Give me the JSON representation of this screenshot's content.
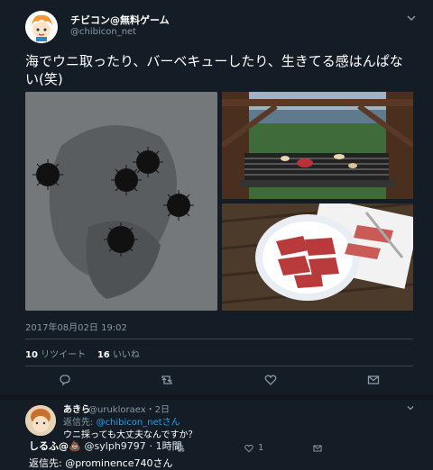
{
  "tweet": {
    "author_name": "チビコン@無料ゲーム",
    "author_handle": "@chibicon_net",
    "text": "海でウニ取ったり、バーベキューしたり、生きてる感はんぱない(笑)",
    "timestamp": "2017年08月02日 19:02",
    "retweet_count": "10",
    "retweet_label": "リツイート",
    "like_count": "16",
    "like_label": "いいね"
  },
  "reply": {
    "author_name": "あきら",
    "author_handle": "@urukloraex",
    "time": "・2日",
    "reply_to_label": "返信先:",
    "reply_to_handle": "@chibicon_netさん",
    "text": "ウニ採っても大丈夫なんですか？",
    "like_count": "1"
  },
  "overlay_reply": {
    "name": "しるふ@💩",
    "handle": "@sylph9797",
    "time": "· 1時間",
    "reply_to": "返信先: @prominence740さん"
  },
  "colors": {
    "background": "#141d26",
    "text_secondary": "#8899a6",
    "link": "#1da1f2",
    "divider": "#38444d"
  }
}
